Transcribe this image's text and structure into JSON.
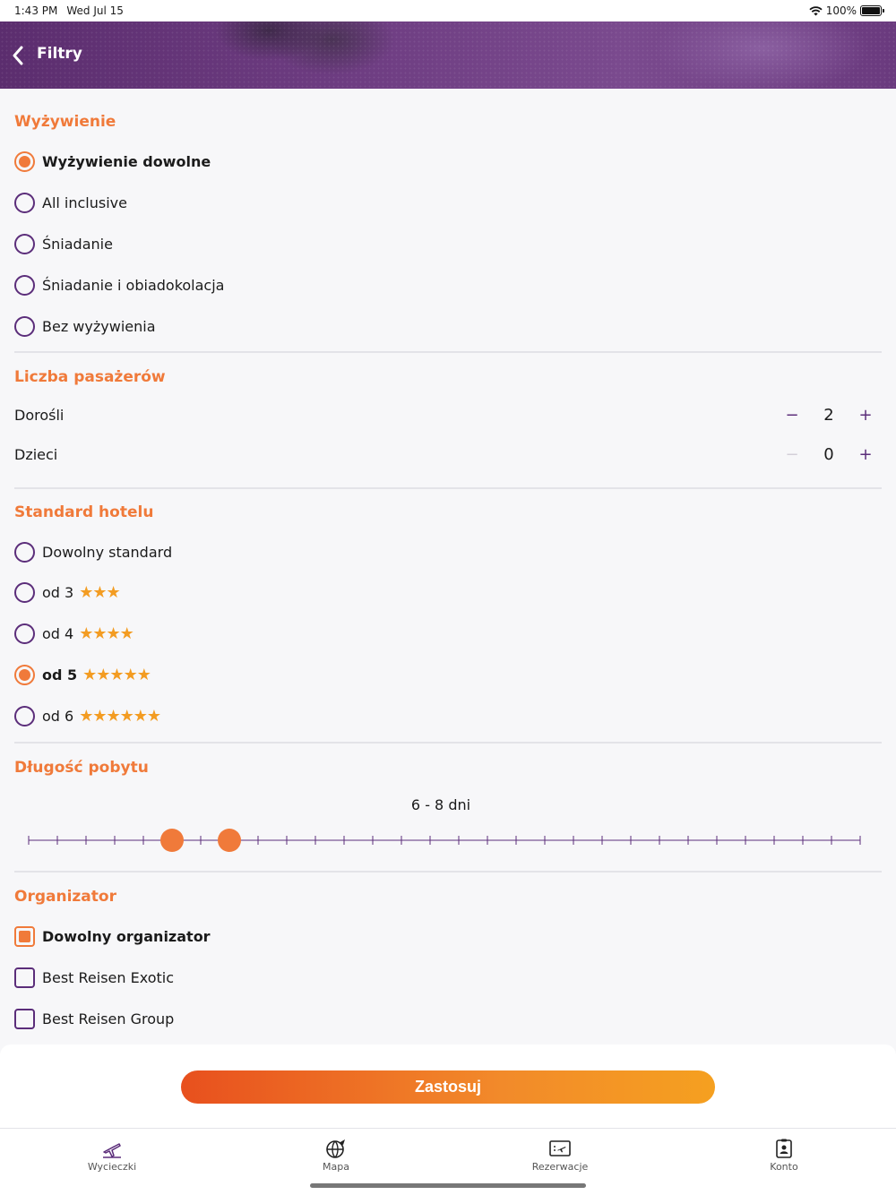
{
  "status_bar": {
    "time": "1:43 PM",
    "date": "Wed Jul 15",
    "battery": "100%"
  },
  "header": {
    "title": "Filtry"
  },
  "meals": {
    "title": "Wyżywienie",
    "options": [
      {
        "label": "Wyżywienie dowolne",
        "selected": true
      },
      {
        "label": "All inclusive",
        "selected": false
      },
      {
        "label": "Śniadanie",
        "selected": false
      },
      {
        "label": "Śniadanie i obiadokolacja",
        "selected": false
      },
      {
        "label": "Bez wyżywienia",
        "selected": false
      }
    ]
  },
  "passengers": {
    "title": "Liczba pasażerów",
    "adults": {
      "label": "Dorośli",
      "value": "2",
      "minus": "−",
      "plus": "+"
    },
    "children": {
      "label": "Dzieci",
      "value": "0",
      "minus": "−",
      "plus": "+"
    }
  },
  "hotel": {
    "title": "Standard hotelu",
    "options": [
      {
        "label": "Dowolny standard",
        "stars": "",
        "selected": false
      },
      {
        "label": "od 3",
        "stars": "★★★",
        "selected": false
      },
      {
        "label": "od 4",
        "stars": "★★★★",
        "selected": false
      },
      {
        "label": "od 5",
        "stars": "★★★★★",
        "selected": true
      },
      {
        "label": "od 6",
        "stars": "★★★★★★",
        "selected": false
      }
    ]
  },
  "stay": {
    "title": "Długość pobytu",
    "range_label": "6 - 8 dni",
    "slider": {
      "ticks": 30,
      "low_index": 5,
      "high_index": 7
    }
  },
  "organizer": {
    "title": "Organizator",
    "options": [
      {
        "label": "Dowolny organizator",
        "selected": true
      },
      {
        "label": "Best Reisen Exotic",
        "selected": false
      },
      {
        "label": "Best Reisen Group",
        "selected": false
      }
    ]
  },
  "apply_label": "Zastosuj",
  "tabs": [
    {
      "label": "Wycieczki",
      "icon": "plane-palm-icon"
    },
    {
      "label": "Mapa",
      "icon": "globe-plane-icon"
    },
    {
      "label": "Rezerwacje",
      "icon": "ticket-plane-icon"
    },
    {
      "label": "Konto",
      "icon": "account-badge-icon"
    }
  ],
  "colors": {
    "accent": "#f07a3a",
    "brand": "#5b2d7a",
    "star": "#f39c22"
  }
}
